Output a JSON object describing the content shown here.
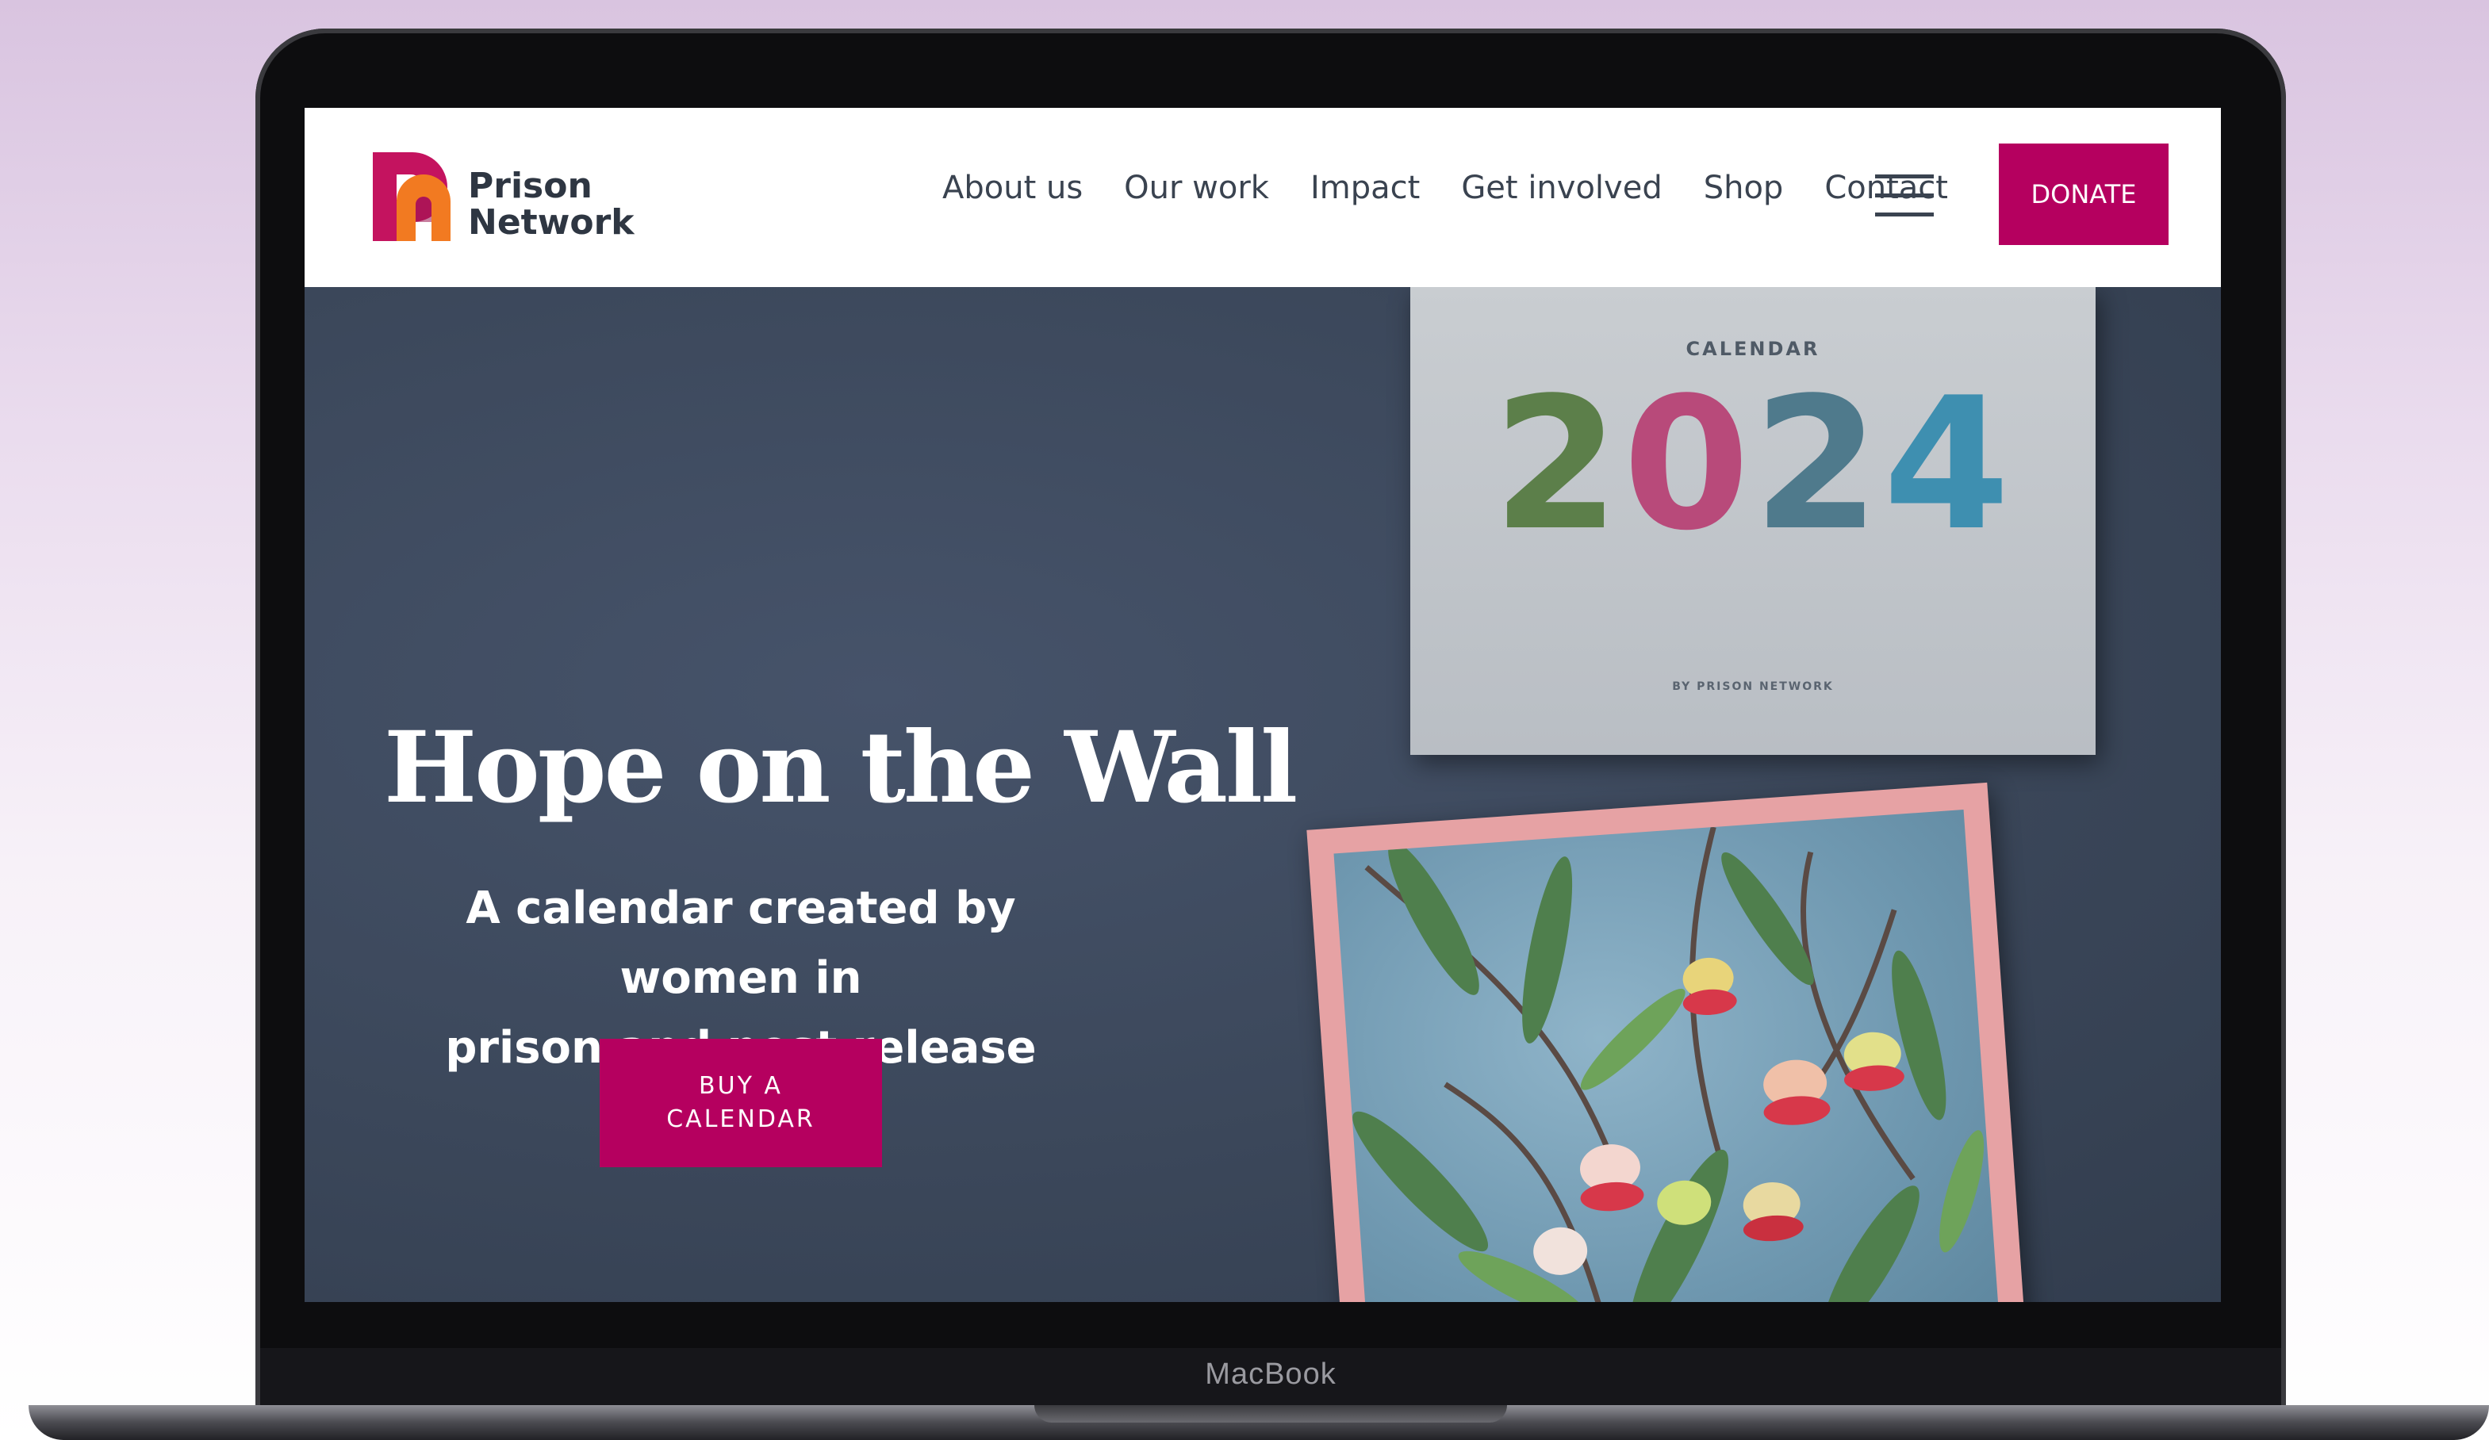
{
  "device": {
    "brand": "MacBook"
  },
  "header": {
    "logo": {
      "line1": "Prison",
      "line2": "Network"
    },
    "nav": [
      "About us",
      "Our work",
      "Impact",
      "Get involved",
      "Shop",
      "Contact"
    ],
    "donate_label": "DONATE"
  },
  "hero": {
    "title": "Hope on the Wall",
    "subtitle_line1": "A calendar created by women in",
    "subtitle_line2": "prison and post release",
    "cta_line1": "BUY A",
    "cta_line2": "CALENDAR"
  },
  "calendar": {
    "label": "CALENDAR",
    "year_digits": [
      "2",
      "0",
      "2",
      "4"
    ],
    "byline": "BY PRISON NETWORK"
  },
  "colors": {
    "accent": "#b5005f",
    "hero_bg": "#3d4a5a",
    "text_dark": "#3a4350"
  }
}
